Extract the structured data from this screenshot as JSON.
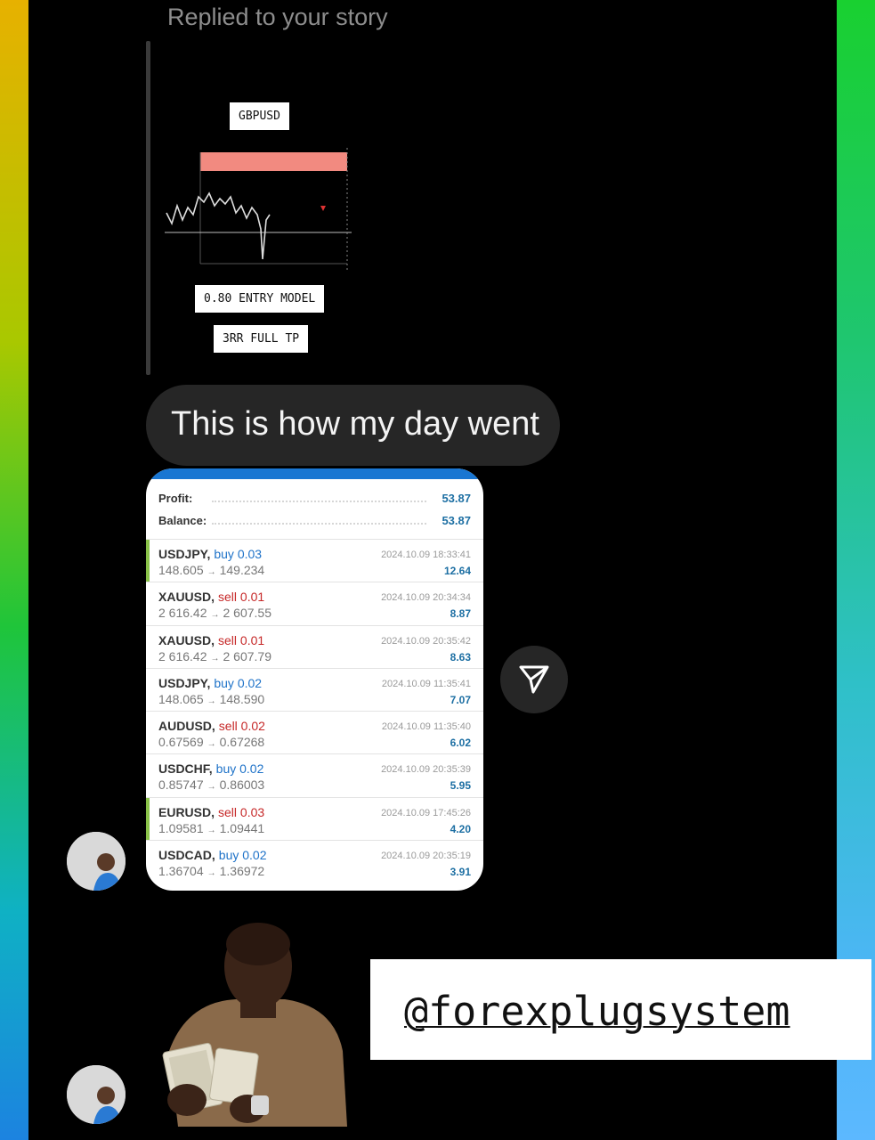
{
  "story_reply": {
    "replied_label": "Replied to your story",
    "preview": {
      "pair_tag": "GBPUSD",
      "entry_tag": "0.80 ENTRY MODEL",
      "tp_tag": "3RR FULL TP"
    }
  },
  "message": {
    "text": "This is how my day went"
  },
  "trade_summary": {
    "profit_label": "Profit:",
    "profit_value": "53.87",
    "balance_label": "Balance:",
    "balance_value": "53.87"
  },
  "trades": [
    {
      "symbol": "USDJPY,",
      "direction": "buy 0.03",
      "side": "buy",
      "open": "148.605",
      "close": "149.234",
      "time": "2024.10.09 18:33:41",
      "profit": "12.64",
      "marked": true
    },
    {
      "symbol": "XAUUSD,",
      "direction": "sell 0.01",
      "side": "sell",
      "open": "2 616.42",
      "close": "2 607.55",
      "time": "2024.10.09 20:34:34",
      "profit": "8.87",
      "marked": false
    },
    {
      "symbol": "XAUUSD,",
      "direction": "sell 0.01",
      "side": "sell",
      "open": "2 616.42",
      "close": "2 607.79",
      "time": "2024.10.09 20:35:42",
      "profit": "8.63",
      "marked": false
    },
    {
      "symbol": "USDJPY,",
      "direction": "buy 0.02",
      "side": "buy",
      "open": "148.065",
      "close": "148.590",
      "time": "2024.10.09 11:35:41",
      "profit": "7.07",
      "marked": false
    },
    {
      "symbol": "AUDUSD,",
      "direction": "sell 0.02",
      "side": "sell",
      "open": "0.67569",
      "close": "0.67268",
      "time": "2024.10.09 11:35:40",
      "profit": "6.02",
      "marked": false
    },
    {
      "symbol": "USDCHF,",
      "direction": "buy 0.02",
      "side": "buy",
      "open": "0.85747",
      "close": "0.86003",
      "time": "2024.10.09 20:35:39",
      "profit": "5.95",
      "marked": false
    },
    {
      "symbol": "EURUSD,",
      "direction": "sell 0.03",
      "side": "sell",
      "open": "1.09581",
      "close": "1.09441",
      "time": "2024.10.09 17:45:26",
      "profit": "4.20",
      "marked": true
    },
    {
      "symbol": "USDCAD,",
      "direction": "buy 0.02",
      "side": "buy",
      "open": "1.36704",
      "close": "1.36972",
      "time": "2024.10.09 20:35:19",
      "profit": "3.91",
      "marked": false
    }
  ],
  "arrow_glyph": "→",
  "share_icon": "paper-plane-icon",
  "handle": "@forexplugsystem",
  "colors": {
    "buy": "#1e72c8",
    "sell": "#c62828",
    "profit": "#1d6fa3",
    "card_header": "#1976d2",
    "bubble": "#262626"
  }
}
